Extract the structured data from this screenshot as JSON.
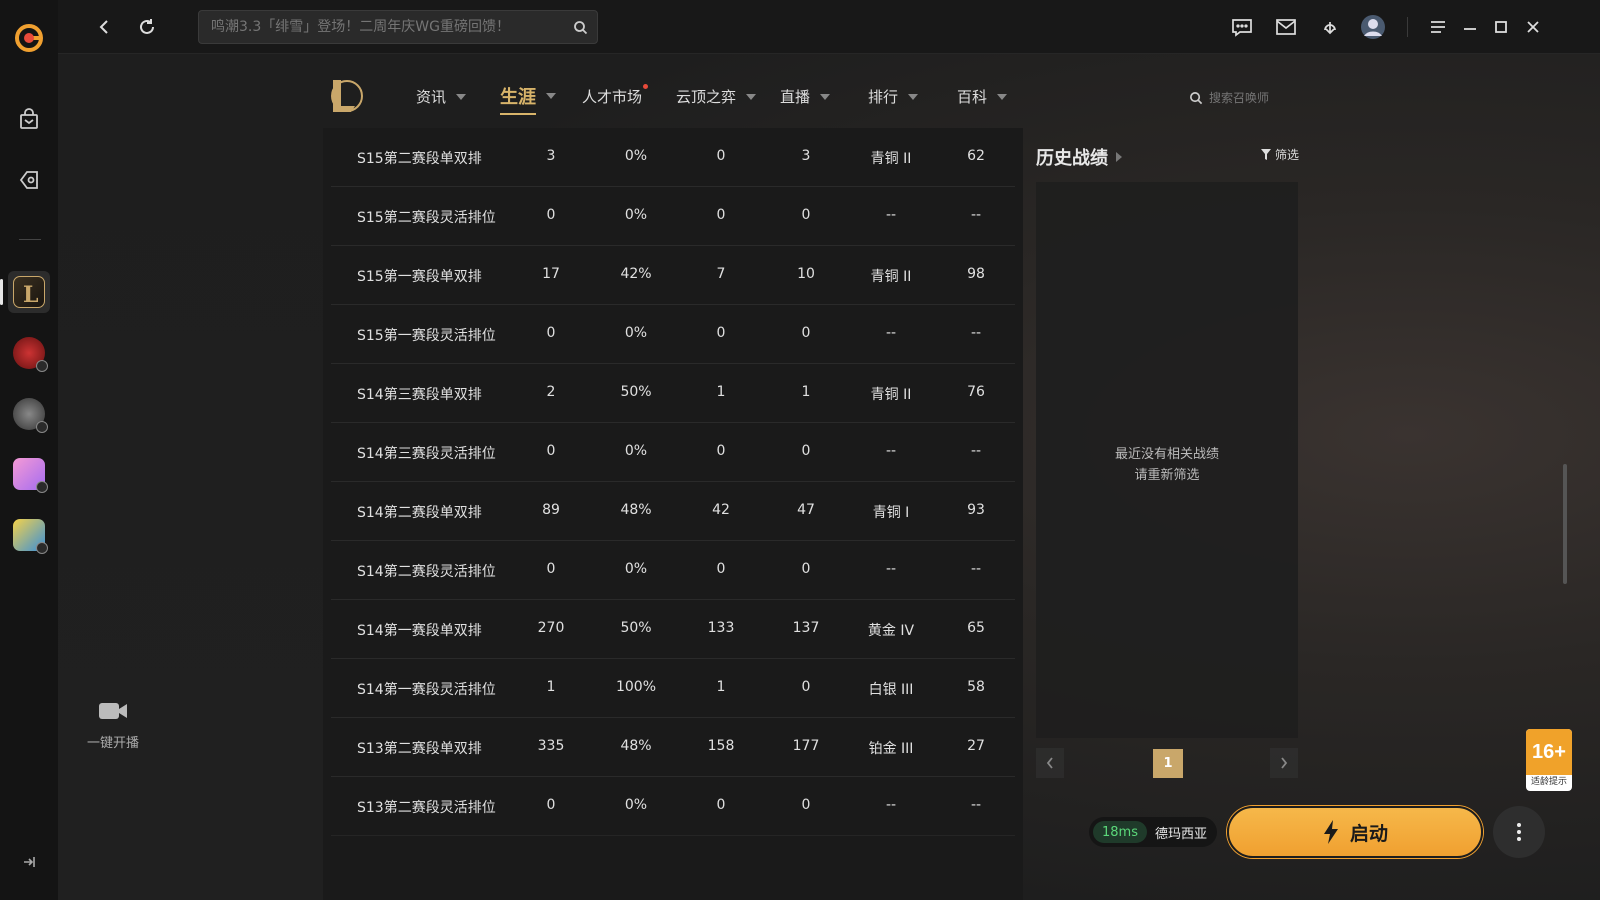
{
  "topbar": {
    "search_placeholder": "鸣潮3.3「绯雪」登场！二周年庆WG重磅回馈！"
  },
  "sidepanel": {
    "broadcast_label": "一键开播"
  },
  "nav": {
    "items": [
      {
        "label": "资讯"
      },
      {
        "label": "生涯"
      },
      {
        "label": "人才市场"
      },
      {
        "label": "云顶之弈"
      },
      {
        "label": "直播"
      },
      {
        "label": "排行"
      },
      {
        "label": "百科"
      }
    ],
    "summoner_search_placeholder": "搜索召唤师"
  },
  "table": {
    "rows": [
      {
        "season": "S15第二赛段单双排",
        "c1": "3",
        "c2": "0%",
        "c3": "0",
        "c4": "3",
        "c5": "青铜 II",
        "c6": "62"
      },
      {
        "season": "S15第二赛段灵活排位",
        "c1": "0",
        "c2": "0%",
        "c3": "0",
        "c4": "0",
        "c5": "--",
        "c6": "--"
      },
      {
        "season": "S15第一赛段单双排",
        "c1": "17",
        "c2": "42%",
        "c3": "7",
        "c4": "10",
        "c5": "青铜 II",
        "c6": "98"
      },
      {
        "season": "S15第一赛段灵活排位",
        "c1": "0",
        "c2": "0%",
        "c3": "0",
        "c4": "0",
        "c5": "--",
        "c6": "--"
      },
      {
        "season": "S14第三赛段单双排",
        "c1": "2",
        "c2": "50%",
        "c3": "1",
        "c4": "1",
        "c5": "青铜 II",
        "c6": "76"
      },
      {
        "season": "S14第三赛段灵活排位",
        "c1": "0",
        "c2": "0%",
        "c3": "0",
        "c4": "0",
        "c5": "--",
        "c6": "--"
      },
      {
        "season": "S14第二赛段单双排",
        "c1": "89",
        "c2": "48%",
        "c3": "42",
        "c4": "47",
        "c5": "青铜 I",
        "c6": "93"
      },
      {
        "season": "S14第二赛段灵活排位",
        "c1": "0",
        "c2": "0%",
        "c3": "0",
        "c4": "0",
        "c5": "--",
        "c6": "--"
      },
      {
        "season": "S14第一赛段单双排",
        "c1": "270",
        "c2": "50%",
        "c3": "133",
        "c4": "137",
        "c5": "黄金 IV",
        "c6": "65"
      },
      {
        "season": "S14第一赛段灵活排位",
        "c1": "1",
        "c2": "100%",
        "c3": "1",
        "c4": "0",
        "c5": "白银 III",
        "c6": "58"
      },
      {
        "season": "S13第二赛段单双排",
        "c1": "335",
        "c2": "48%",
        "c3": "158",
        "c4": "177",
        "c5": "铂金 III",
        "c6": "27"
      },
      {
        "season": "S13第二赛段灵活排位",
        "c1": "0",
        "c2": "0%",
        "c3": "0",
        "c4": "0",
        "c5": "--",
        "c6": "--"
      }
    ]
  },
  "history": {
    "title": "历史战绩",
    "filter_label": "筛选",
    "empty_line1": "最近没有相关战绩",
    "empty_line2": "请重新筛选",
    "current_page": "1"
  },
  "age_badge": {
    "rating": "16+",
    "caption": "适龄提示"
  },
  "launch": {
    "ping": "18ms",
    "server": "德玛西亚",
    "button_label": "启动"
  },
  "colors": {
    "accent_gold": "#d8b46a",
    "launch_orange": "#f0a030",
    "ping_green": "#5bd87a"
  }
}
